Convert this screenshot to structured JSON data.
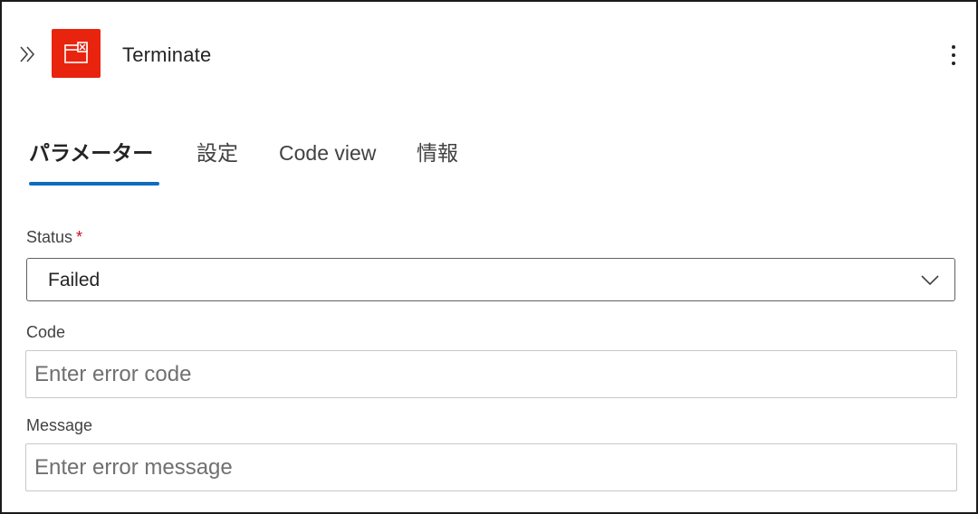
{
  "header": {
    "title": "Terminate",
    "collapse_icon": "double-chevron-right-icon",
    "action_icon": "terminate-icon",
    "more_icon": "more-vertical-icon"
  },
  "tabs": [
    {
      "label": "パラメーター",
      "active": true
    },
    {
      "label": "設定",
      "active": false
    },
    {
      "label": "Code view",
      "active": false
    },
    {
      "label": "情報",
      "active": false
    }
  ],
  "form": {
    "status": {
      "label": "Status",
      "required_marker": "*",
      "value": "Failed"
    },
    "code": {
      "label": "Code",
      "placeholder": "Enter error code"
    },
    "message": {
      "label": "Message",
      "placeholder": "Enter error message"
    }
  },
  "colors": {
    "action_icon_bg": "#e8240f",
    "tab_underline": "#0f6cbd",
    "required": "#c50f1f"
  }
}
